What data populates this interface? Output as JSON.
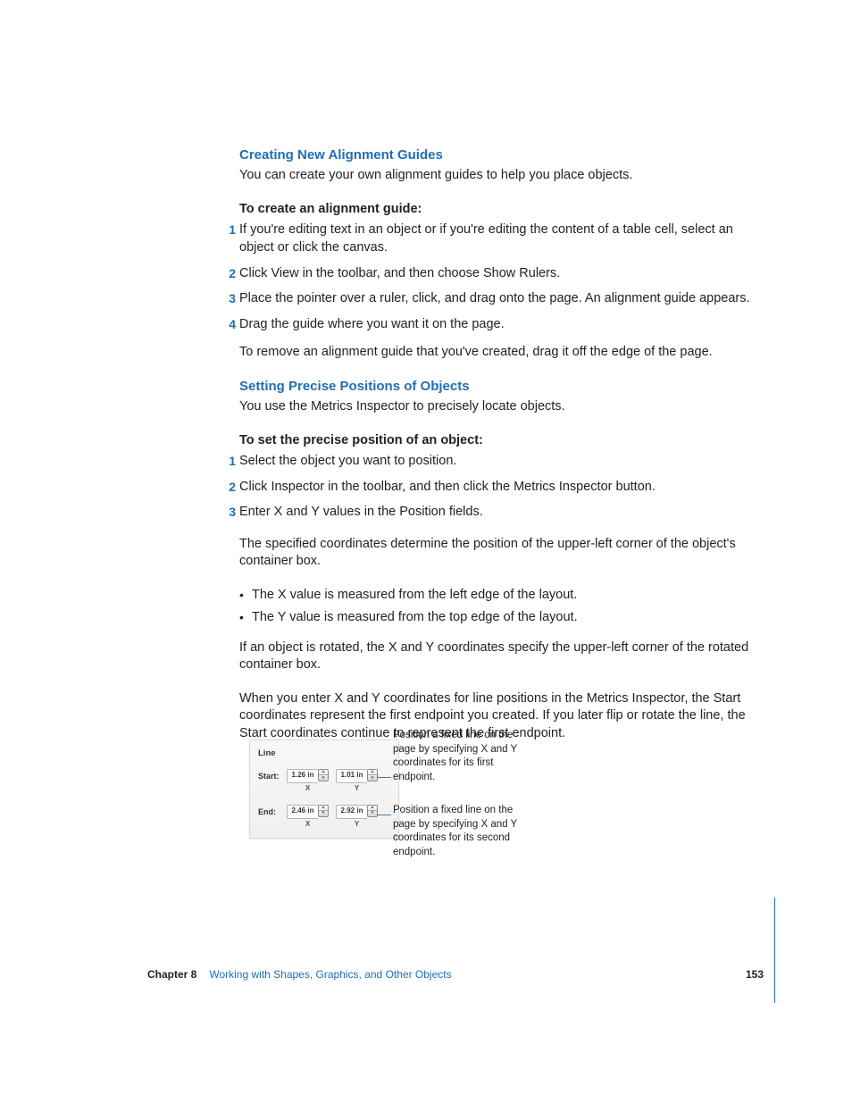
{
  "section1": {
    "heading": "Creating New Alignment Guides",
    "intro": "You can create your own alignment guides to help you place objects.",
    "lead": "To create an alignment guide:",
    "steps": [
      "If you're editing text in an object or if you're editing the content of a table cell, select an object or click the canvas.",
      "Click View in the toolbar, and then choose Show Rulers.",
      "Place the pointer over a ruler, click, and drag onto the page. An alignment guide appears.",
      "Drag the guide where you want it on the page."
    ],
    "after": "To remove an alignment guide that you've created, drag it off the edge of the page."
  },
  "section2": {
    "heading": "Setting Precise Positions of Objects",
    "intro": "You use the Metrics Inspector to precisely locate objects.",
    "lead": "To set the precise position of an object:",
    "steps": [
      "Select the object you want to position.",
      "Click Inspector in the toolbar, and then click the Metrics Inspector button.",
      "Enter X and Y values in the Position fields."
    ],
    "para1": "The specified coordinates determine the position of the upper-left corner of the object's container box.",
    "bullets": [
      "The X value is measured from the left edge of the layout.",
      "The Y value is measured from the top edge of the layout."
    ],
    "para2": "If an object is rotated, the X and Y coordinates specify the upper-left corner of the rotated container box.",
    "para3": "When you enter X and Y coordinates for line positions in the Metrics Inspector, the Start coordinates represent the first endpoint you created. If you later flip or rotate the line, the Start coordinates continue to represent the first endpoint."
  },
  "figure": {
    "panel_title": "Line",
    "rows": [
      {
        "label": "Start:",
        "x": "1.26 in",
        "y": "1.01 in"
      },
      {
        "label": "End:",
        "x": "2.46 in",
        "y": "2.92 in"
      }
    ],
    "axis_x": "X",
    "axis_y": "Y",
    "callout1": "Position a fixed line on the page by specifying X and Y coordinates for its first endpoint.",
    "callout2": "Position a fixed line on the page by specifying X and Y coordinates for its second endpoint."
  },
  "footer": {
    "chapter": "Chapter 8",
    "title": "Working with Shapes, Graphics, and Other Objects",
    "page": "153"
  }
}
